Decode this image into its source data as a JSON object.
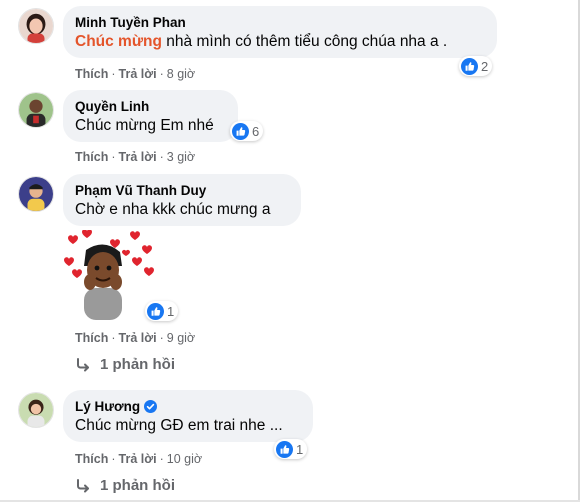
{
  "colors": {
    "bubble_bg": "#f0f2f5",
    "meta_text": "#65676b",
    "highlight": "#e4552b",
    "like_blue": "#1877f2"
  },
  "icons": {
    "like": "like-thumb-icon",
    "verified": "verified-badge-icon",
    "reply": "reply-arrow-icon"
  },
  "comments": [
    {
      "author": "Minh Tuyền Phan",
      "text_highlight": "Chúc mừng",
      "text": " nhà mình có thêm tiểu công chúa nha a .",
      "reaction_count": "2",
      "actions": {
        "like": "Thích",
        "reply": "Trả lời",
        "time": "8 giờ"
      }
    },
    {
      "author": "Quyền Linh",
      "text": "Chúc mừng Em nhé",
      "reaction_count": "6",
      "actions": {
        "like": "Thích",
        "reply": "Trả lời",
        "time": "3 giờ"
      }
    },
    {
      "author": "Phạm Vũ Thanh Duy",
      "text": "Chờ e nha kkk chúc mưng a",
      "reaction_count": "1",
      "actions": {
        "like": "Thích",
        "reply": "Trả lời",
        "time": "9 giờ"
      },
      "replies": "1 phản hồi"
    },
    {
      "author": "Lý Hương",
      "verified": true,
      "text": "Chúc mừng GĐ em trai nhe ...",
      "reaction_count": "1",
      "actions": {
        "like": "Thích",
        "reply": "Trả lời",
        "time": "10 giờ"
      },
      "replies": "1 phản hồi"
    }
  ]
}
